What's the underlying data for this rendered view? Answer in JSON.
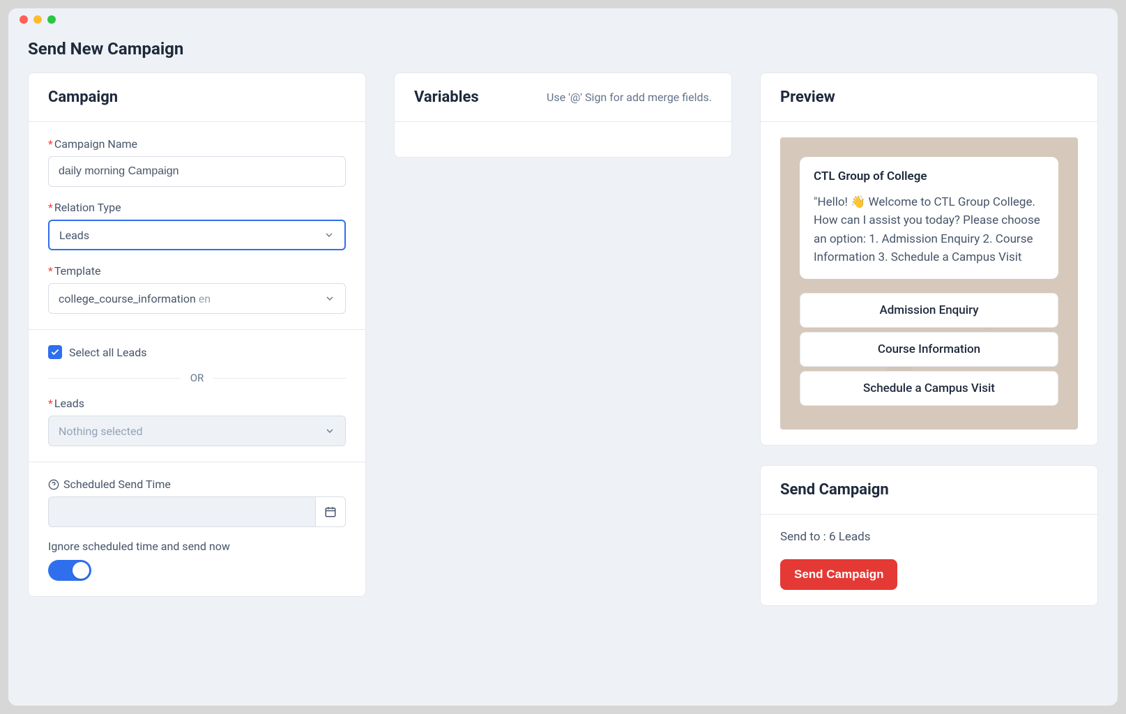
{
  "page": {
    "title": "Send New Campaign"
  },
  "campaign": {
    "card_title": "Campaign",
    "name_label": "Campaign Name",
    "name_value": "daily morning Campaign",
    "relation_label": "Relation Type",
    "relation_value": "Leads",
    "template_label": "Template",
    "template_value": "college_course_information",
    "template_lang": "en",
    "select_all_label": "Select all Leads",
    "or_text": "OR",
    "leads_label": "Leads",
    "leads_placeholder": "Nothing selected",
    "scheduled_label": "Scheduled Send Time",
    "scheduled_value": "",
    "ignore_label": "Ignore scheduled time and send now"
  },
  "variables": {
    "card_title": "Variables",
    "hint": "Use '@' Sign for add merge fields."
  },
  "preview": {
    "card_title": "Preview",
    "bubble_title": "CTL Group of College",
    "bubble_text": "\"Hello! 👋 Welcome to CTL Group College. How can I assist you today? Please choose an option: 1. Admission Enquiry 2. Course Information 3. Schedule a Campus Visit",
    "buttons": [
      "Admission Enquiry",
      "Course Information",
      "Schedule a Campus Visit"
    ]
  },
  "send": {
    "card_title": "Send Campaign",
    "summary": "Send to : 6 Leads",
    "button_label": "Send Campaign"
  }
}
